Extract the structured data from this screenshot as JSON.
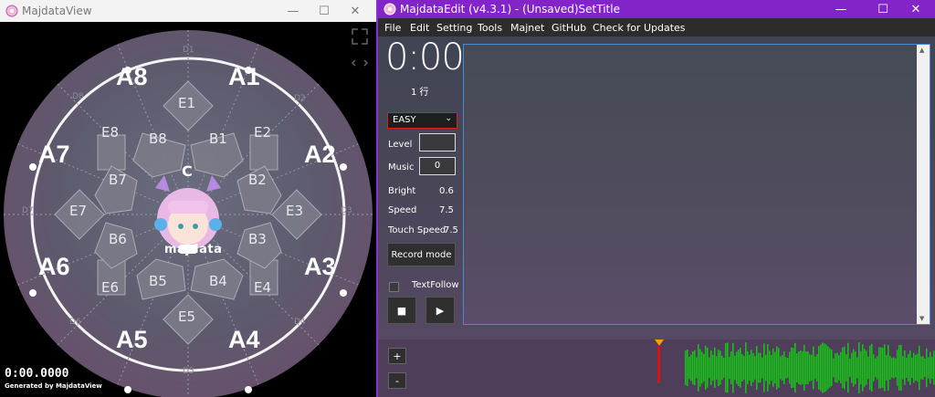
{
  "view_window": {
    "title": "MajdataView",
    "buttons": {
      "minimize": "—",
      "maximize": "☐",
      "close": "✕"
    },
    "sensors": {
      "center": "C",
      "a": [
        "A1",
        "A2",
        "A3",
        "A4",
        "A5",
        "A6",
        "A7",
        "A8"
      ],
      "b": [
        "B1",
        "B2",
        "B3",
        "B4",
        "B5",
        "B6",
        "B7",
        "B8"
      ],
      "d": [
        "D1",
        "D2",
        "D3",
        "D4",
        "D5",
        "D6",
        "D7",
        "D8"
      ],
      "e": [
        "E1",
        "E2",
        "E3",
        "E4",
        "E5",
        "E6",
        "E7",
        "E8"
      ]
    },
    "logo_text": "majdata",
    "time": "0:00.0000",
    "generated_by": "Generated by MajdataView"
  },
  "edit_window": {
    "title": "MajdataEdit (v4.3.1) - (Unsaved)SetTitle",
    "buttons": {
      "minimize": "—",
      "maximize": "☐",
      "close": "✕"
    },
    "menu": [
      "File",
      "Edit",
      "Setting",
      "Tools",
      "Majnet",
      "GitHub",
      "Check for Updates"
    ],
    "time_display": "0:00",
    "line_display": "1 行",
    "difficulty": "EASY",
    "level_label": "Level",
    "level_value": "",
    "music_label": "Music",
    "music_value": "0",
    "bright_label": "Bright",
    "bright_value": "0.6",
    "speed_label": "Speed",
    "speed_value": "7.5",
    "touch_speed_label": "Touch Speed",
    "touch_speed_value": "7.5",
    "record_mode": "Record mode",
    "text_follow": "TextFollow",
    "stop": "■",
    "play": "▶",
    "zoom_in": "+",
    "zoom_out": "-",
    "colors": {
      "accent": "#8224c8",
      "waveform": "#16c416",
      "cursor": "#e01010",
      "marker": "#f0a000"
    }
  }
}
